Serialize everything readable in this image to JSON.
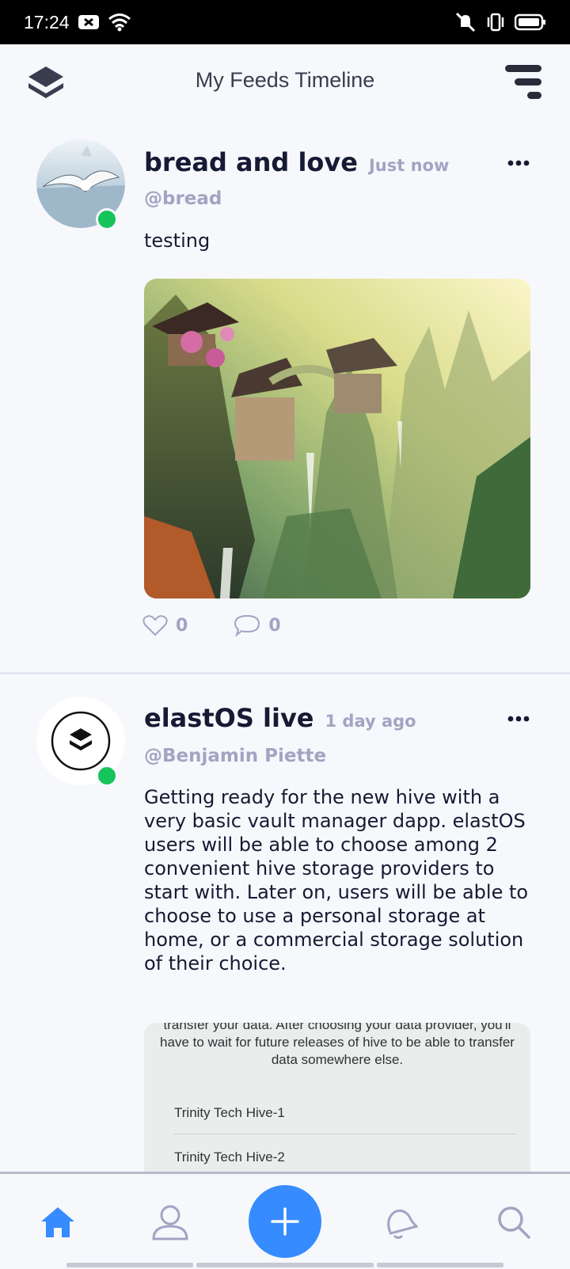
{
  "status_bar": {
    "time": "17:24"
  },
  "header": {
    "title": "My Feeds Timeline"
  },
  "posts": [
    {
      "name": "bread and love",
      "time": "Just now",
      "handle": "@bread",
      "text": "testing",
      "likes": "0",
      "comments": "0"
    },
    {
      "name": "elastOS live",
      "time": "1 day ago",
      "handle": "@Benjamin Piette",
      "text": "Getting ready for the new hive with a very basic vault manager dapp. elastOS users will be able to choose among 2 convenient hive storage providers to start with. Later on, users will be able to choose to use a personal storage at home, or a commercial storage solution of their choice.",
      "embed": {
        "text": "transfer your data. After choosing your data provider, you'll have to wait for future releases of hive to be able to transfer data somewhere else.",
        "options": [
          "Trinity Tech Hive-1",
          "Trinity Tech Hive-2"
        ]
      }
    }
  ],
  "colors": {
    "accent": "#368bff",
    "online": "#17c35b",
    "muted": "#a3a4c2"
  }
}
